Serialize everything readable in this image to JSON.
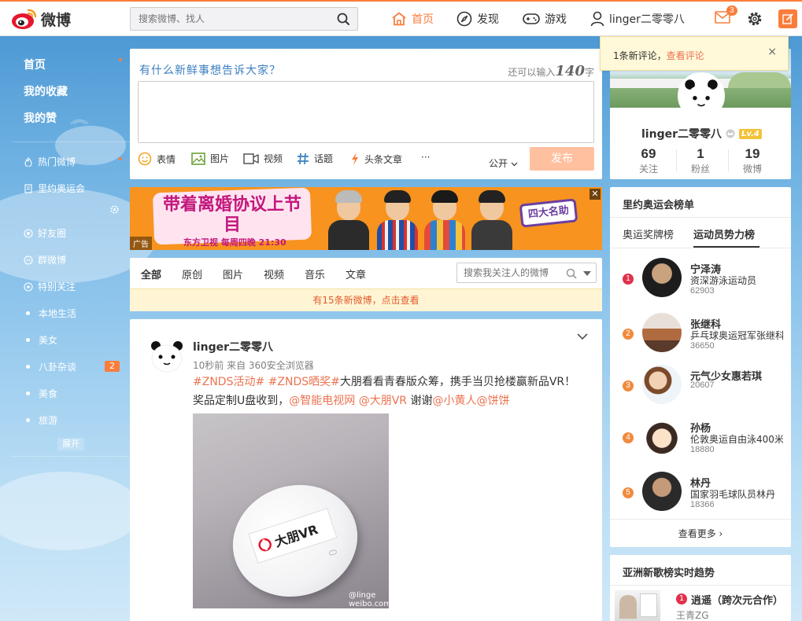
{
  "brand": {
    "logo_text": "微博",
    "accent": "#fa7d3c"
  },
  "search": {
    "placeholder": "搜索微博、找人"
  },
  "nav": {
    "home": "首页",
    "discover": "发现",
    "games": "游戏",
    "user": "linger二零零八",
    "message_badge": "3"
  },
  "left_nav": {
    "main": [
      "首页",
      "我的收藏",
      "我的赞"
    ],
    "topics": [
      "热门微博",
      "里约奥运会"
    ],
    "groups": [
      "好友圈",
      "群微博",
      "特别关注"
    ],
    "categories": [
      "本地生活",
      "美女",
      "八卦杂谈",
      "美食",
      "旅游"
    ],
    "gossip_badge": "2",
    "expand": "展开"
  },
  "composer": {
    "prompt": "有什么新鲜事想告诉大家？",
    "remain_prefix": "还可以输入",
    "remain_count": "140",
    "remain_suffix": "字",
    "tools": [
      "表情",
      "图片",
      "视频",
      "话题",
      "头条文章"
    ],
    "more": "···",
    "visibility": "公开",
    "publish": "发布"
  },
  "ad": {
    "title": "带着离婚协议上节目",
    "sub": "东方卫视 每周四晚 21:30",
    "tag": "广告",
    "logo": "四大名助",
    "close": "✕"
  },
  "feed_tabs": {
    "tabs": [
      "全部",
      "原创",
      "图片",
      "视频",
      "音乐",
      "文章"
    ],
    "search_placeholder": "搜索我关注人的微博",
    "new_notice": "有15条新微博，点击查看"
  },
  "post": {
    "author": "linger二零零八",
    "meta": "10秒前 来自 360安全浏览器",
    "tag1": "#ZNDS活动#",
    "tag2": "#ZNDS晒奖#",
    "text1": "大朋看看青春版众筹，携手当贝抢楼赢新品VR！奖品定制U盘收到，",
    "mention1": "@智能电视网",
    "mention2": "@大朋VR",
    "text2": " 谢谢",
    "mention3": "@小黄人",
    "mention4": "@饼饼",
    "image_label": "大朋VR",
    "watermark_line1": "@linge",
    "watermark_line2": "weibo.com/u/58"
  },
  "notification": {
    "text": "1条新评论，",
    "link": "查看评论",
    "close": "×"
  },
  "profile": {
    "name": "linger二零零八",
    "level": "Lv.4",
    "stats": [
      {
        "num": "69",
        "label": "关注"
      },
      {
        "num": "1",
        "label": "粉丝"
      },
      {
        "num": "19",
        "label": "微博"
      }
    ]
  },
  "rank": {
    "title": "里约奥运会榜单",
    "tabs": [
      "奥运奖牌榜",
      "运动员势力榜"
    ],
    "items": [
      {
        "rank": "1",
        "name": "宁泽涛",
        "desc": "资深游泳运动员",
        "count": "62903",
        "color": "#e0314b"
      },
      {
        "rank": "2",
        "name": "张继科",
        "desc": "乒乓球奥运冠军张继科",
        "count": "36650",
        "color": "#f08a3c"
      },
      {
        "rank": "3",
        "name": "元气少女惠若琪",
        "desc": "",
        "count": "20607",
        "color": "#f08a3c"
      },
      {
        "rank": "4",
        "name": "孙杨",
        "desc": "伦敦奥运自由泳400米冠军",
        "count": "18880",
        "color": "#f08a3c"
      },
      {
        "rank": "5",
        "name": "林丹",
        "desc": "国家羽毛球队员林丹",
        "count": "18366",
        "color": "#f08a3c"
      }
    ],
    "more": "查看更多 ›"
  },
  "trend": {
    "title": "亚洲新歌榜实时趋势",
    "rank": "1",
    "song": "逍遥（跨次元合作）",
    "artist": "王青ZG"
  }
}
